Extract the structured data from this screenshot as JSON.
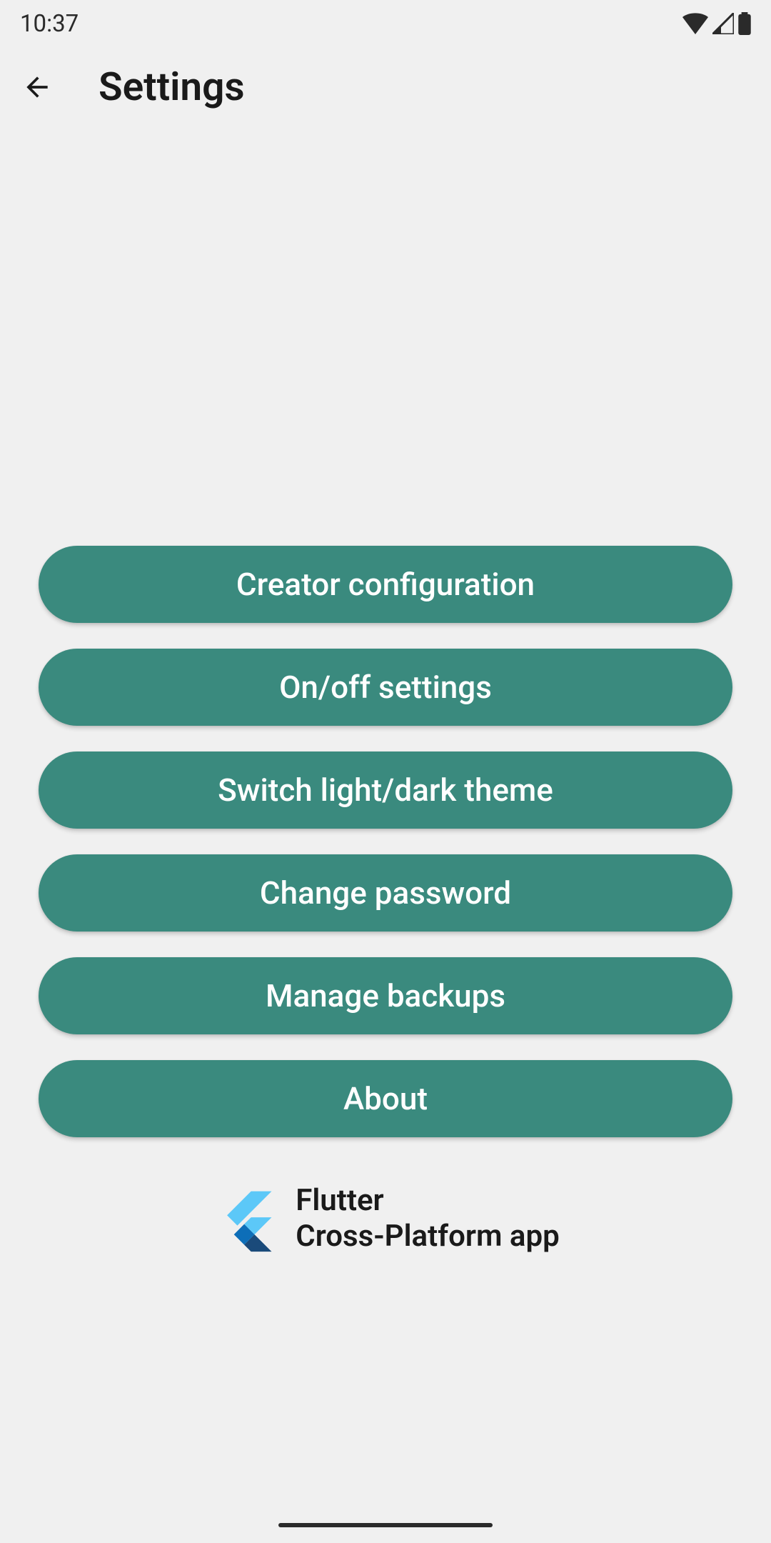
{
  "statusBar": {
    "time": "10:37"
  },
  "header": {
    "title": "Settings"
  },
  "buttons": [
    {
      "label": "Creator configuration",
      "name": "creator-configuration-button"
    },
    {
      "label": "On/off settings",
      "name": "on-off-settings-button"
    },
    {
      "label": "Switch light/dark theme",
      "name": "switch-theme-button"
    },
    {
      "label": "Change password",
      "name": "change-password-button"
    },
    {
      "label": "Manage backups",
      "name": "manage-backups-button"
    },
    {
      "label": "About",
      "name": "about-button"
    }
  ],
  "footer": {
    "line1": "Flutter",
    "line2": "Cross-Platform app"
  },
  "colors": {
    "buttonBg": "#3a8a7e",
    "pageBg": "#f0f0f0"
  }
}
